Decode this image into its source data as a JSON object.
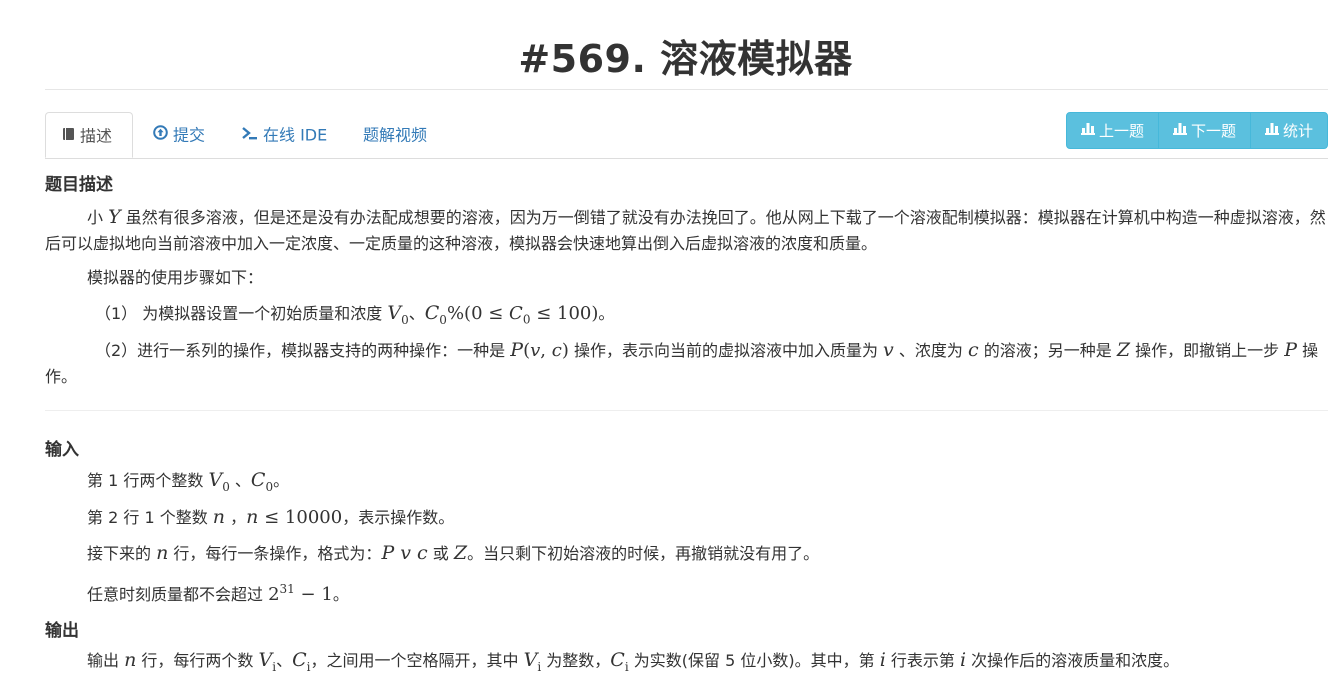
{
  "title": "#569. 溶液模拟器",
  "tabs": {
    "describe": "描述",
    "submit": "提交",
    "online_ide": "在线 IDE",
    "solution_video": "题解视频"
  },
  "buttons": {
    "prev": "上一题",
    "next": "下一题",
    "stats": "统计"
  },
  "description": {
    "heading": "题目描述",
    "para1_a": "小 ",
    "para1_Y": "Y",
    "para1_b": " 虽然有很多溶液，但是还是没有办法配成想要的溶液，因为万一倒错了就没有办法挽回了。他从网上下载了一个溶液配制模拟器：模拟器在计算机中构造一种虚拟溶液，然后可以虚拟地向当前溶液中加入一定浓度、一定质量的这种溶液，模拟器会快速地算出倒入后虚拟溶液的浓度和质量。",
    "para2": "模拟器的使用步骤如下：",
    "step1_a": "（1） 为模拟器设置一个初始质量和浓度 ",
    "step1_end": "。",
    "step2_a": "（2）进行一系列的操作，模拟器支持的两种操作：一种是 ",
    "step2_b": " 操作，表示向当前的虚拟溶液中加入质量为 ",
    "step2_c": " 、浓度为 ",
    "step2_d": " 的溶液；另一种是 ",
    "step2_e": " 操作，即撤销上一步 ",
    "step2_f": " 操作。"
  },
  "input": {
    "heading": "输入",
    "l1_a": "第 1 行两个整数 ",
    "l1_b": " 、",
    "l1_end": "。",
    "l2_a": "第 2 行 1 个整数 ",
    "l2_b": " ，",
    "l2_c": "，表示操作数。",
    "l3_a": "接下来的 ",
    "l3_b": " 行，每行一条操作，格式为：",
    "l3_c": " 或 ",
    "l3_d": "。当只剩下初始溶液的时候，再撤销就没有用了。",
    "l4_a": "任意时刻质量都不会超过 ",
    "l4_end": "。"
  },
  "output": {
    "heading": "输出",
    "l1_a": "输出 ",
    "l1_b": " 行，每行两个数 ",
    "l1_c": "、",
    "l1_d": "，之间用一个空格隔开，其中 ",
    "l1_e": " 为整数，",
    "l1_f": " 为实数(保留 5 位小数)。其中，第 ",
    "l1_g": " 行表示第 ",
    "l1_h": " 次操作后的溶液质量和浓度。"
  }
}
